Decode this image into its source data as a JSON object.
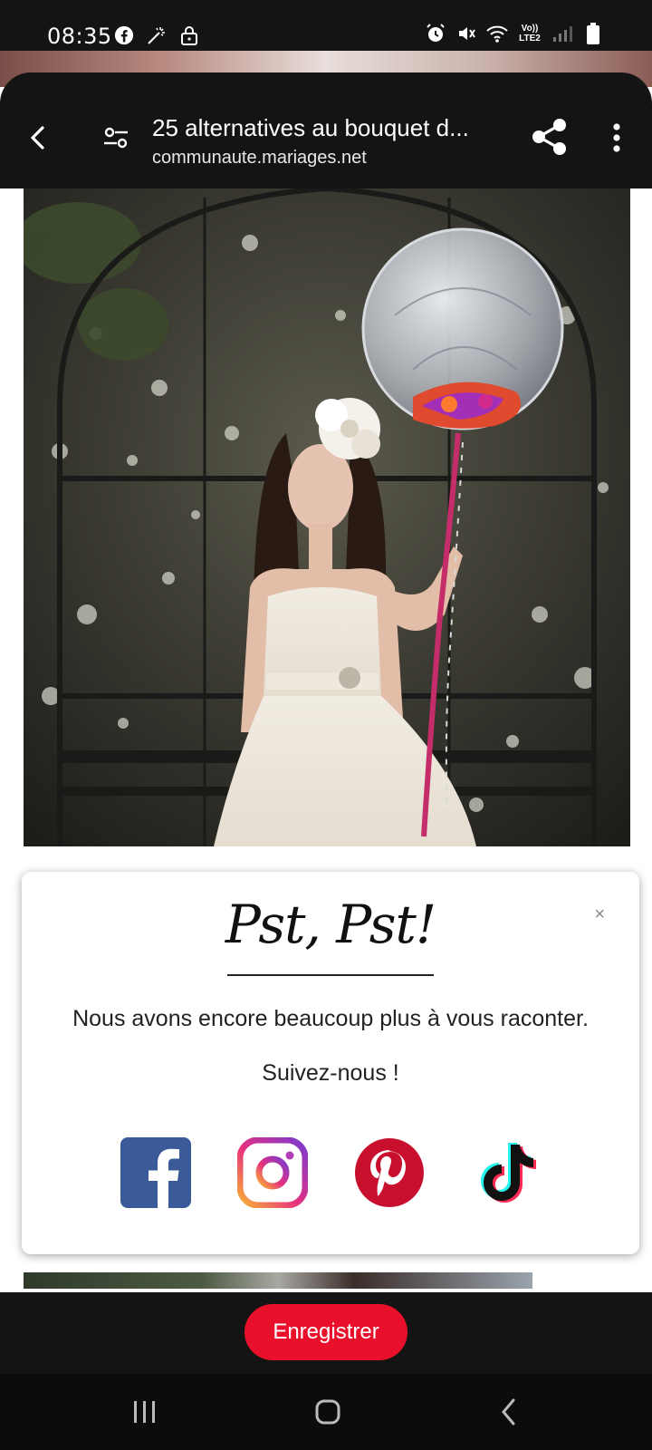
{
  "status_bar": {
    "time": "08:35",
    "volte_top": "Vo))",
    "volte_bottom": "LTE2",
    "left_icons": [
      "facebook-icon",
      "magic-wand-icon",
      "lock-icon"
    ],
    "right_icons": [
      "alarm-icon",
      "mute-icon",
      "wifi-icon",
      "volte-icon",
      "signal-icon",
      "battery-icon"
    ]
  },
  "browser": {
    "title": "25 alternatives au bouquet d...",
    "url": "communaute.mariages.net",
    "icons": [
      "back-icon",
      "site-settings-icon",
      "share-icon",
      "more-vert-icon"
    ]
  },
  "popup": {
    "headline": "Pst, Pst!",
    "text": "Nous avons encore beaucoup plus à vous raconter.",
    "follow": "Suivez-nous !",
    "close": "×",
    "social": [
      "facebook",
      "instagram",
      "pinterest",
      "tiktok"
    ]
  },
  "bottom": {
    "save_label": "Enregistrer"
  },
  "colors": {
    "accent": "#e8102a",
    "facebook": "#3b5a9a",
    "pinterest": "#c8102e",
    "bar": "#141414"
  }
}
